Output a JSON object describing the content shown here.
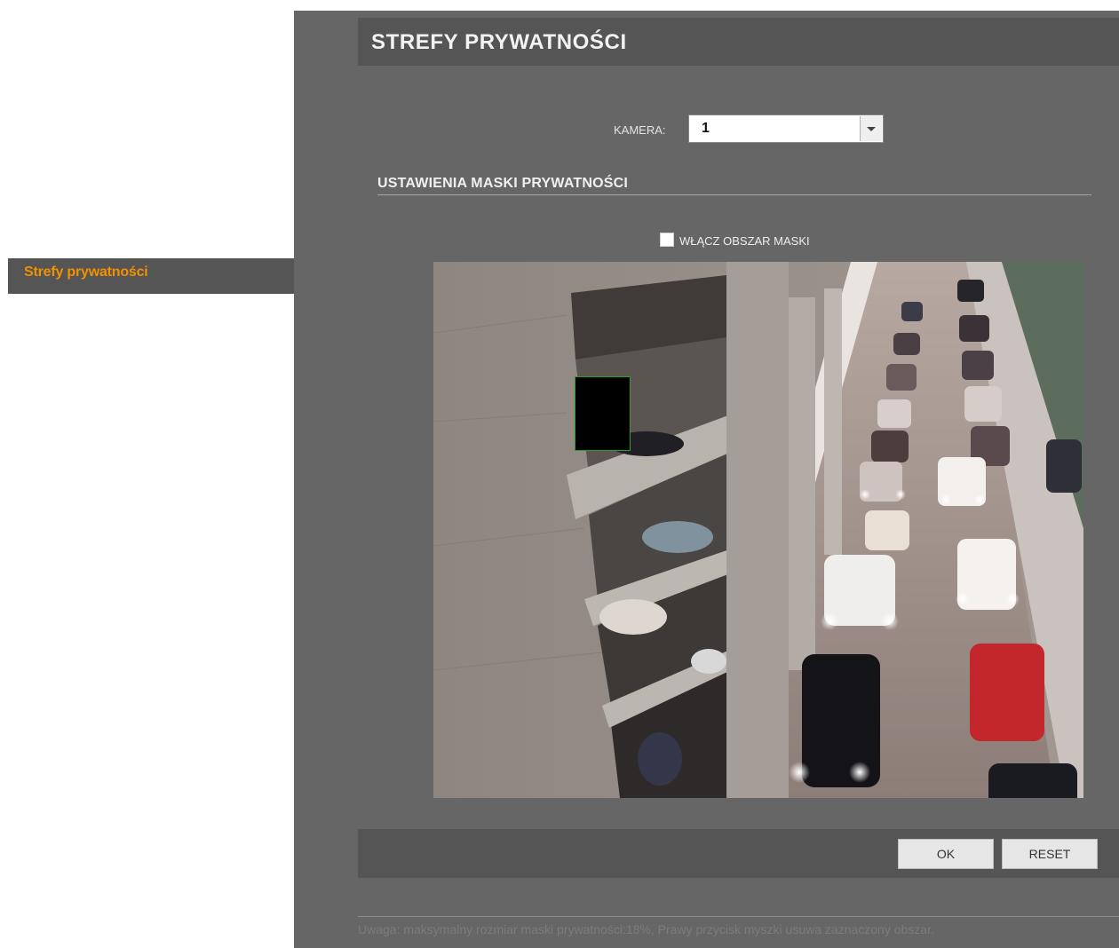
{
  "sidebar": {
    "items": [
      {
        "label": "Strefy prywatności",
        "active": true
      }
    ],
    "accent_color": "#f29100"
  },
  "header": {
    "title": "STREFY PRYWATNOŚCI"
  },
  "camera_select": {
    "label": "KAMERA:",
    "value": "1"
  },
  "section": {
    "title": "USTAWIENIA MASKI PRYWATNOŚCI"
  },
  "mask_toggle": {
    "label": "WŁĄCZ OBSZAR MASKI",
    "checked": false
  },
  "preview": {
    "description_icon": "camera-feed",
    "mask_zones_count": 1
  },
  "buttons": {
    "ok": "OK",
    "reset": "RESET"
  },
  "note": "Uwaga: maksymalny rozmiar maski prywatności:18%, Prawy przycisk myszki usuwa zaznaczony obszar.",
  "colors": {
    "panel": "#666666",
    "bar": "#555555",
    "mask_border": "#27a127"
  }
}
